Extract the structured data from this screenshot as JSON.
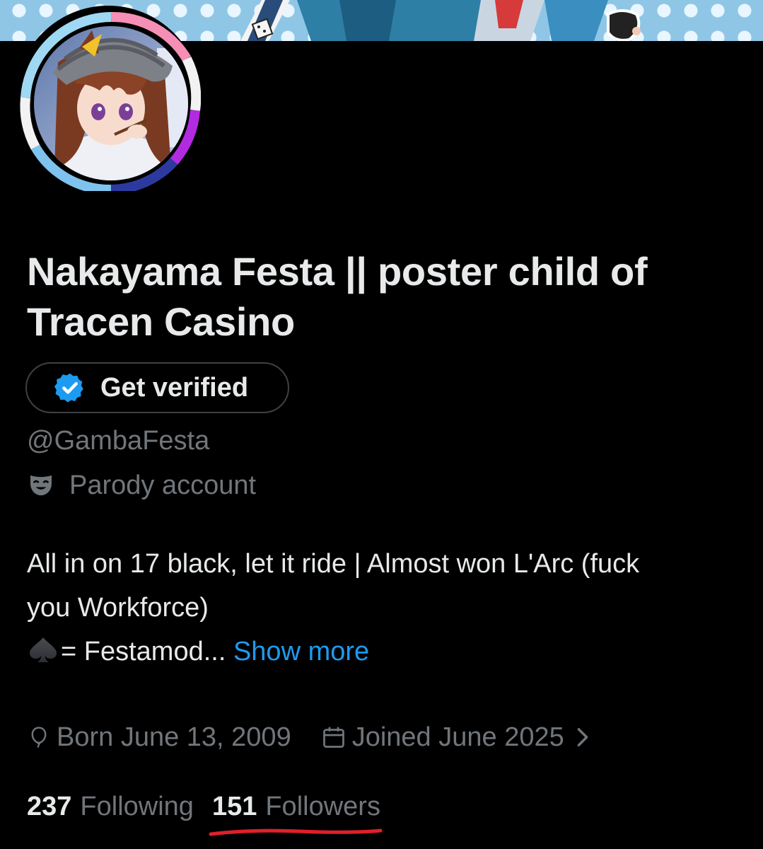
{
  "profile": {
    "display_name_line1": "Nakayama Festa || poster child of",
    "display_name_line2": "Tracen Casino",
    "get_verified_label": "Get verified",
    "handle": "@GambaFesta",
    "parody_label": "Parody account",
    "bio": {
      "line1": "All in on 17 black, let it ride | Almost won L'Arc (fuck",
      "line2": "you Workforce)",
      "line3": "= Festamod...",
      "show_more": "Show more"
    },
    "born": "Born June 13, 2009",
    "joined": "Joined June 2025",
    "following_count": "237",
    "following_label": "Following",
    "followers_count": "151",
    "followers_label": "Followers"
  },
  "colors": {
    "background": "#000000",
    "text_primary": "#e7e9ea",
    "text_secondary": "#71767b",
    "link": "#1d9bf0",
    "verified": "#1d9bf0",
    "annotation_underline": "#e0202a"
  },
  "icons": {
    "verified": "verified-badge-icon",
    "parody": "theater-mask-icon",
    "born": "balloon-icon",
    "joined": "calendar-icon",
    "chevron": "chevron-right-icon",
    "spade": "spade-icon"
  }
}
